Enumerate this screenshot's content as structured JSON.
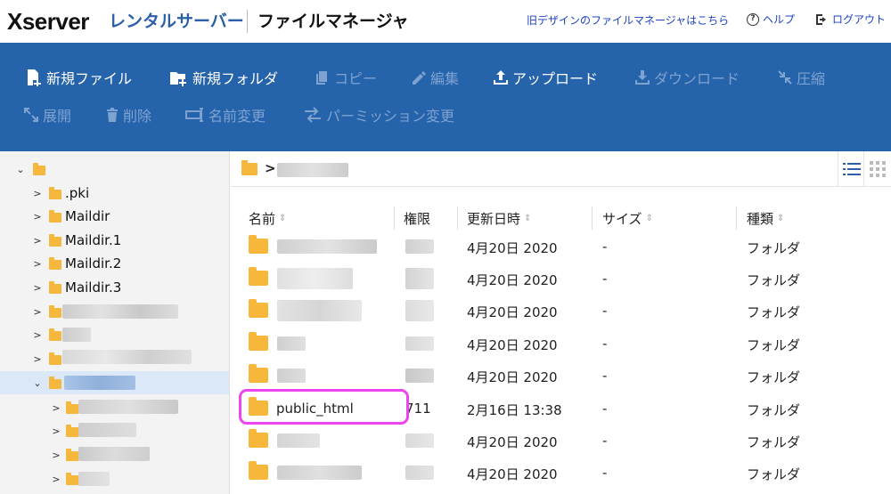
{
  "header": {
    "logo_x": "X",
    "logo_rest": "server",
    "logo_sub": "レンタルサーバー",
    "app_title": "ファイルマネージャ",
    "old_design_link": "旧デザインのファイルマネージャはこちら",
    "help_label": "ヘルプ",
    "logout_label": "ログアウト"
  },
  "toolbar": {
    "new_file": "新規ファイル",
    "new_folder": "新規フォルダ",
    "copy": "コピー",
    "edit": "編集",
    "upload": "アップロード",
    "download": "ダウンロード",
    "compress": "圧縮",
    "extract": "展開",
    "delete": "削除",
    "rename": "名前変更",
    "permission": "パーミッション変更"
  },
  "tree": {
    "items": [
      {
        "label": ".pki"
      },
      {
        "label": "Maildir"
      },
      {
        "label": "Maildir.1"
      },
      {
        "label": "Maildir.2"
      },
      {
        "label": "Maildir.3"
      }
    ]
  },
  "table": {
    "columns": {
      "name": "名前",
      "permission": "権限",
      "modified": "更新日時",
      "size": "サイズ",
      "type": "種類"
    },
    "rows": [
      {
        "name": "",
        "perm": "",
        "modified": "4月20日 2020",
        "size": "-",
        "type": "フォルダ"
      },
      {
        "name": "",
        "perm": "",
        "modified": "4月20日 2020",
        "size": "-",
        "type": "フォルダ"
      },
      {
        "name": "",
        "perm": "",
        "modified": "4月20日 2020",
        "size": "-",
        "type": "フォルダ"
      },
      {
        "name": "",
        "perm": "",
        "modified": "4月20日 2020",
        "size": "-",
        "type": "フォルダ"
      },
      {
        "name": "",
        "perm": "",
        "modified": "4月20日 2020",
        "size": "-",
        "type": "フォルダ"
      },
      {
        "name": "public_html",
        "perm": "711",
        "modified": "2月16日 13:38",
        "size": "-",
        "type": "フォルダ"
      },
      {
        "name": "",
        "perm": "",
        "modified": "4月20日 2020",
        "size": "-",
        "type": "フォルダ"
      },
      {
        "name": "",
        "perm": "",
        "modified": "4月20日 2020",
        "size": "-",
        "type": "フォルダ"
      }
    ]
  },
  "colors": {
    "toolbar_bg": "#2563ab",
    "folder": "#f7b73a",
    "highlight": "#ee44ee",
    "link": "#1a3fbf"
  }
}
